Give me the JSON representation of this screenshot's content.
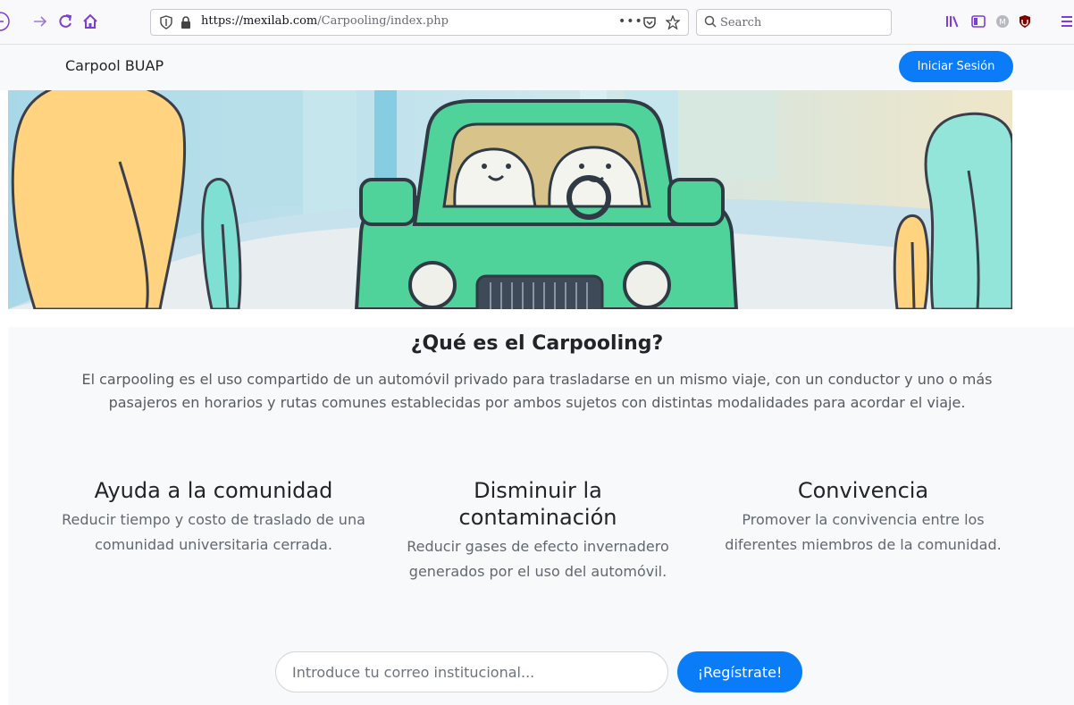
{
  "browser": {
    "url_host": "https://mexilab.com",
    "url_path": "/Carpooling/index.php",
    "more_label": "•••",
    "search_placeholder": "Search",
    "accent_color": "#7a3ed9"
  },
  "navbar": {
    "brand": "Carpool BUAP",
    "login_label": "Iniciar Sesión",
    "button_color": "#0b7cf7"
  },
  "main": {
    "title": "¿Qué es el Carpooling?",
    "description": "El carpooling es el uso compartido de un automóvil privado para trasladarse en un mismo viaje, con un conductor y uno o más pasajeros en horarios y rutas comunes establecidas por ambos sujetos con distintas modalidades para acordar el viaje."
  },
  "features": [
    {
      "title": "Ayuda a la comunidad",
      "text": "Reducir tiempo y costo de traslado de una comunidad universitaria cerrada."
    },
    {
      "title": "Disminuir la contaminación",
      "text": "Reducir gases de efecto invernadero generados por el uso del automóvil."
    },
    {
      "title": "Convivencia",
      "text": "Promover la convivencia entre los diferentes miembros de la comunidad."
    }
  ],
  "signup": {
    "email_placeholder": "Introduce tu correo institucional...",
    "email_value": "",
    "register_label": "¡Regístrate!"
  }
}
